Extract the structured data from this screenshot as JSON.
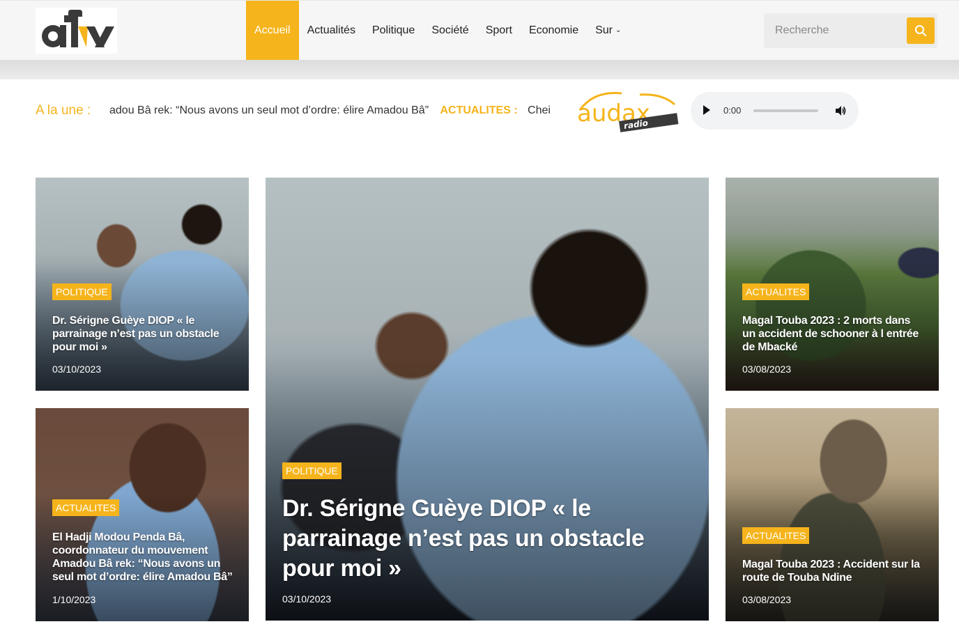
{
  "header": {
    "logo_text": "atv",
    "nav": [
      {
        "label": "Accueil",
        "active": true
      },
      {
        "label": "Actualités",
        "active": false
      },
      {
        "label": "Politique",
        "active": false
      },
      {
        "label": "Société",
        "active": false
      },
      {
        "label": "Sport",
        "active": false
      },
      {
        "label": "Economie",
        "active": false
      },
      {
        "label": "Sur",
        "active": false,
        "has_dropdown": true
      }
    ],
    "search": {
      "placeholder": "Recherche",
      "icon": "search-icon"
    }
  },
  "ticker": {
    "label": "A la une :",
    "items": [
      {
        "text": "adou Bâ rek: “Nous avons un seul mot d’ordre: élire Amadou Bâ”"
      },
      {
        "category": "ACTUALITES :",
        "text": "Cheikh Bamba..."
      }
    ]
  },
  "radio": {
    "logo_text": "audax",
    "logo_sub": "radio",
    "player": {
      "time": "0:00",
      "play_icon": "play-icon",
      "volume_icon": "volume-icon"
    }
  },
  "articles": [
    {
      "category": "POLITIQUE",
      "title": "Dr. Sérigne Guèye DIOP « le parrainage n’est pas un obstacle pour moi »",
      "date": "03/10/2023"
    },
    {
      "category": "ACTUALITES",
      "title": "El Hadji Modou Penda Bâ, coordonnateur du mouvement Amadou Bâ rek: “Nous avons un seul mot d’ordre: élire Amadou Bâ”",
      "date": "1/10/2023"
    },
    {
      "category": "POLITIQUE",
      "title": "Dr. Sérigne Guèye DIOP « le parrainage n’est pas un obstacle pour moi »",
      "date": "03/10/2023"
    },
    {
      "category": "ACTUALITES",
      "title": "Magal Touba 2023 : 2 morts dans un accident de schooner à l entrée de Mbacké",
      "date": "03/08/2023"
    },
    {
      "category": "ACTUALITES",
      "title": "Magal Touba 2023 : Accident sur la route de Touba Ndine",
      "date": "03/08/2023"
    }
  ],
  "colors": {
    "accent": "#f5b41b",
    "header_bg": "#f6f6f6",
    "text": "#222222"
  }
}
